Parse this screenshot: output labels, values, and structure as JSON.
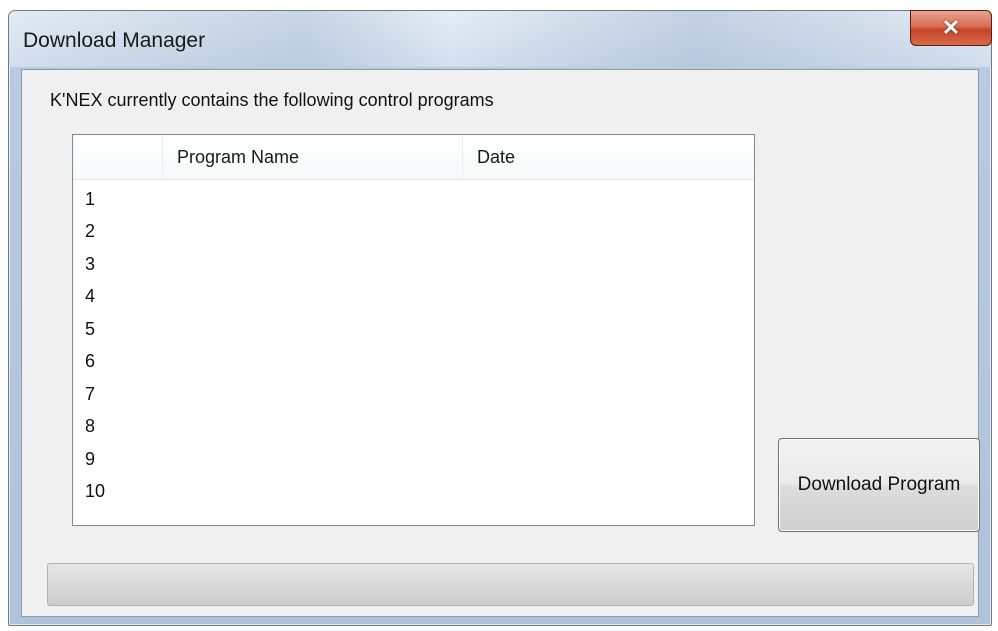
{
  "window": {
    "title": "Download Manager",
    "close_glyph": "✕"
  },
  "main": {
    "info_label": "K'NEX currently contains the following control programs",
    "table": {
      "columns": [
        "",
        "Program Name",
        "Date"
      ],
      "rows": [
        {
          "num": "1",
          "name": "",
          "date": ""
        },
        {
          "num": "2",
          "name": "",
          "date": ""
        },
        {
          "num": "3",
          "name": "",
          "date": ""
        },
        {
          "num": "4",
          "name": "",
          "date": ""
        },
        {
          "num": "5",
          "name": "",
          "date": ""
        },
        {
          "num": "6",
          "name": "",
          "date": ""
        },
        {
          "num": "7",
          "name": "",
          "date": ""
        },
        {
          "num": "8",
          "name": "",
          "date": ""
        },
        {
          "num": "9",
          "name": "",
          "date": ""
        },
        {
          "num": "10",
          "name": "",
          "date": ""
        }
      ]
    },
    "download_button_label": "Download Program",
    "progress": {
      "value": 0
    }
  },
  "colors": {
    "close_button": "#c6442a",
    "dialog_background": "#f0f0f0",
    "frame": "#b9cbe0"
  },
  "icons": {
    "close": "close-icon"
  }
}
